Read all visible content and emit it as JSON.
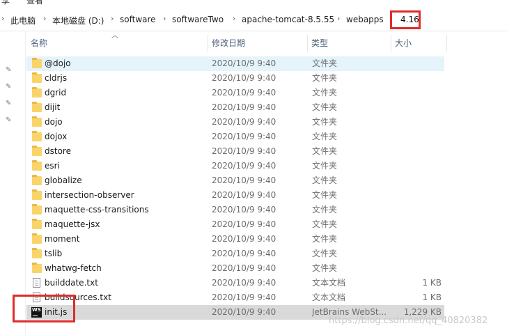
{
  "ribbon": {
    "item1": "享",
    "item2": "查看"
  },
  "address": {
    "crumbs": [
      "此电脑",
      "本地磁盘 (D:)",
      "software",
      "softwareTwo",
      "apache-tomcat-8.5.55",
      "webapps"
    ],
    "separator": "›",
    "annotation": "4.16"
  },
  "columns": {
    "name": "名称",
    "date": "修改日期",
    "type": "类型",
    "size": "大小"
  },
  "files": [
    {
      "name": "@dojo",
      "date": "2020/10/9 9:40",
      "type": "文件夹",
      "size": "",
      "icon": "folder-icon"
    },
    {
      "name": "cldrjs",
      "date": "2020/10/9 9:40",
      "type": "文件夹",
      "size": "",
      "icon": "folder-icon"
    },
    {
      "name": "dgrid",
      "date": "2020/10/9 9:40",
      "type": "文件夹",
      "size": "",
      "icon": "folder-icon"
    },
    {
      "name": "dijit",
      "date": "2020/10/9 9:40",
      "type": "文件夹",
      "size": "",
      "icon": "folder-icon"
    },
    {
      "name": "dojo",
      "date": "2020/10/9 9:40",
      "type": "文件夹",
      "size": "",
      "icon": "folder-icon"
    },
    {
      "name": "dojox",
      "date": "2020/10/9 9:40",
      "type": "文件夹",
      "size": "",
      "icon": "folder-icon"
    },
    {
      "name": "dstore",
      "date": "2020/10/9 9:40",
      "type": "文件夹",
      "size": "",
      "icon": "folder-icon"
    },
    {
      "name": "esri",
      "date": "2020/10/9 9:40",
      "type": "文件夹",
      "size": "",
      "icon": "folder-icon"
    },
    {
      "name": "globalize",
      "date": "2020/10/9 9:40",
      "type": "文件夹",
      "size": "",
      "icon": "folder-icon"
    },
    {
      "name": "intersection-observer",
      "date": "2020/10/9 9:40",
      "type": "文件夹",
      "size": "",
      "icon": "folder-icon"
    },
    {
      "name": "maquette-css-transitions",
      "date": "2020/10/9 9:40",
      "type": "文件夹",
      "size": "",
      "icon": "folder-icon"
    },
    {
      "name": "maquette-jsx",
      "date": "2020/10/9 9:40",
      "type": "文件夹",
      "size": "",
      "icon": "folder-icon"
    },
    {
      "name": "moment",
      "date": "2020/10/9 9:40",
      "type": "文件夹",
      "size": "",
      "icon": "folder-icon"
    },
    {
      "name": "tslib",
      "date": "2020/10/9 9:40",
      "type": "文件夹",
      "size": "",
      "icon": "folder-icon"
    },
    {
      "name": "whatwg-fetch",
      "date": "2020/10/9 9:40",
      "type": "文件夹",
      "size": "",
      "icon": "folder-icon"
    },
    {
      "name": "builddate.txt",
      "date": "2020/10/9 9:40",
      "type": "文本文档",
      "size": "1 KB",
      "icon": "text-file-icon"
    },
    {
      "name": "buildsources.txt",
      "date": "2020/10/9 9:40",
      "type": "文本文档",
      "size": "1 KB",
      "icon": "text-file-icon"
    },
    {
      "name": "init.js",
      "date": "2020/10/9 9:40",
      "type": "JetBrains WebSt...",
      "size": "1,229 KB",
      "icon": "webstorm-file-icon"
    }
  ],
  "icons": {
    "webstorm_label": "WS",
    "pin": "pin-icon",
    "sort": "sort-ascending-icon"
  },
  "watermark": "https://blog.csdn.net/qq_40820382",
  "colors": {
    "highlight": "#e02b2b",
    "hover_row": "#e5f3fb",
    "selected_row": "#d9d9d9",
    "folder": "#f8d46b"
  }
}
